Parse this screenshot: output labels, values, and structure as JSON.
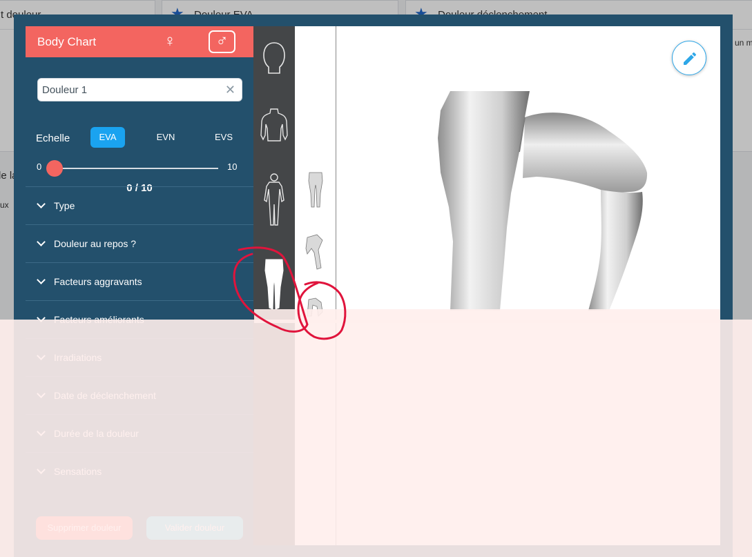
{
  "background": {
    "card_left_title": "t douleur",
    "card_mid_title": "Douleur EVA",
    "card_right_title": "Douleur déclenchement",
    "card_right_snippet": "un m",
    "left_text_1": "le la d",
    "left_text_2": "ux"
  },
  "modal": {
    "title": "Body Chart",
    "female_symbol": "♀",
    "male_symbol": "♂",
    "search": {
      "value": "Douleur 1",
      "clear_symbol": "✕"
    },
    "scale": {
      "label": "Echelle",
      "options": [
        "EVA",
        "EVN",
        "EVS"
      ],
      "selected": "EVA"
    },
    "slider": {
      "min": "0",
      "max": "10",
      "value": 0,
      "display": "0 / 10"
    },
    "accordion": [
      "Type",
      "Douleur au repos ?",
      "Facteurs aggravants",
      "Facteurs améliorants",
      "Irradiations",
      "Date de déclenchement",
      "Durée de la douleur",
      "Sensations"
    ],
    "buttons": {
      "delete": "Supprimer douleur",
      "validate": "Valider douleur"
    }
  },
  "colors": {
    "accent": "#f36560",
    "panel": "#23506c",
    "scale_active": "#1aa3f0",
    "ink": "#e0143c"
  },
  "icons": {
    "edit": "pencil-icon",
    "clear": "close-icon",
    "chevron": "chevron-down-icon"
  }
}
